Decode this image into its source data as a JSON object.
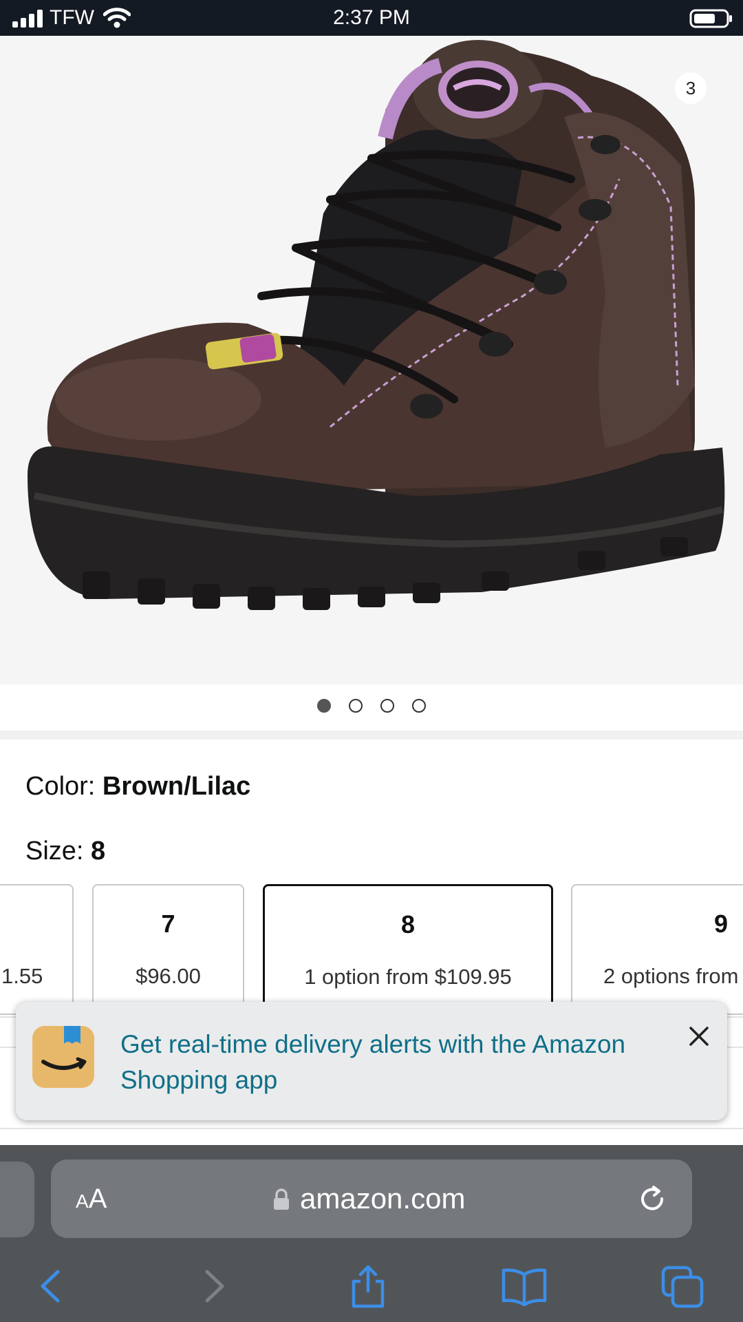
{
  "status_bar": {
    "carrier": "TFW",
    "time": "2:37 PM"
  },
  "product_gallery": {
    "image_count": "3",
    "image_alt": "Brown and lilac waterproof hiking work boot",
    "dots_total": 4,
    "active_dot": 0
  },
  "variation": {
    "color_label": "Color: ",
    "color_value": "Brown/Lilac",
    "size_label": "Size: ",
    "size_value": "8",
    "sizes": [
      {
        "label": "",
        "price": "1.55"
      },
      {
        "label": "7",
        "price": "$96.00"
      },
      {
        "label": "8",
        "price": "1 option from $109.95"
      },
      {
        "label": "9",
        "price": "2 options from"
      }
    ]
  },
  "app_banner": {
    "text": "Get real-time delivery alerts with the Amazon Shopping app"
  },
  "browser": {
    "aa_small": "A",
    "aa_large": "A",
    "url": "amazon.com"
  },
  "colors": {
    "banner_text": "#0f6f88",
    "safari_blue": "#3b8ee8",
    "status_bar_bg": "#141a24",
    "toolbar_bg": "#525558"
  }
}
